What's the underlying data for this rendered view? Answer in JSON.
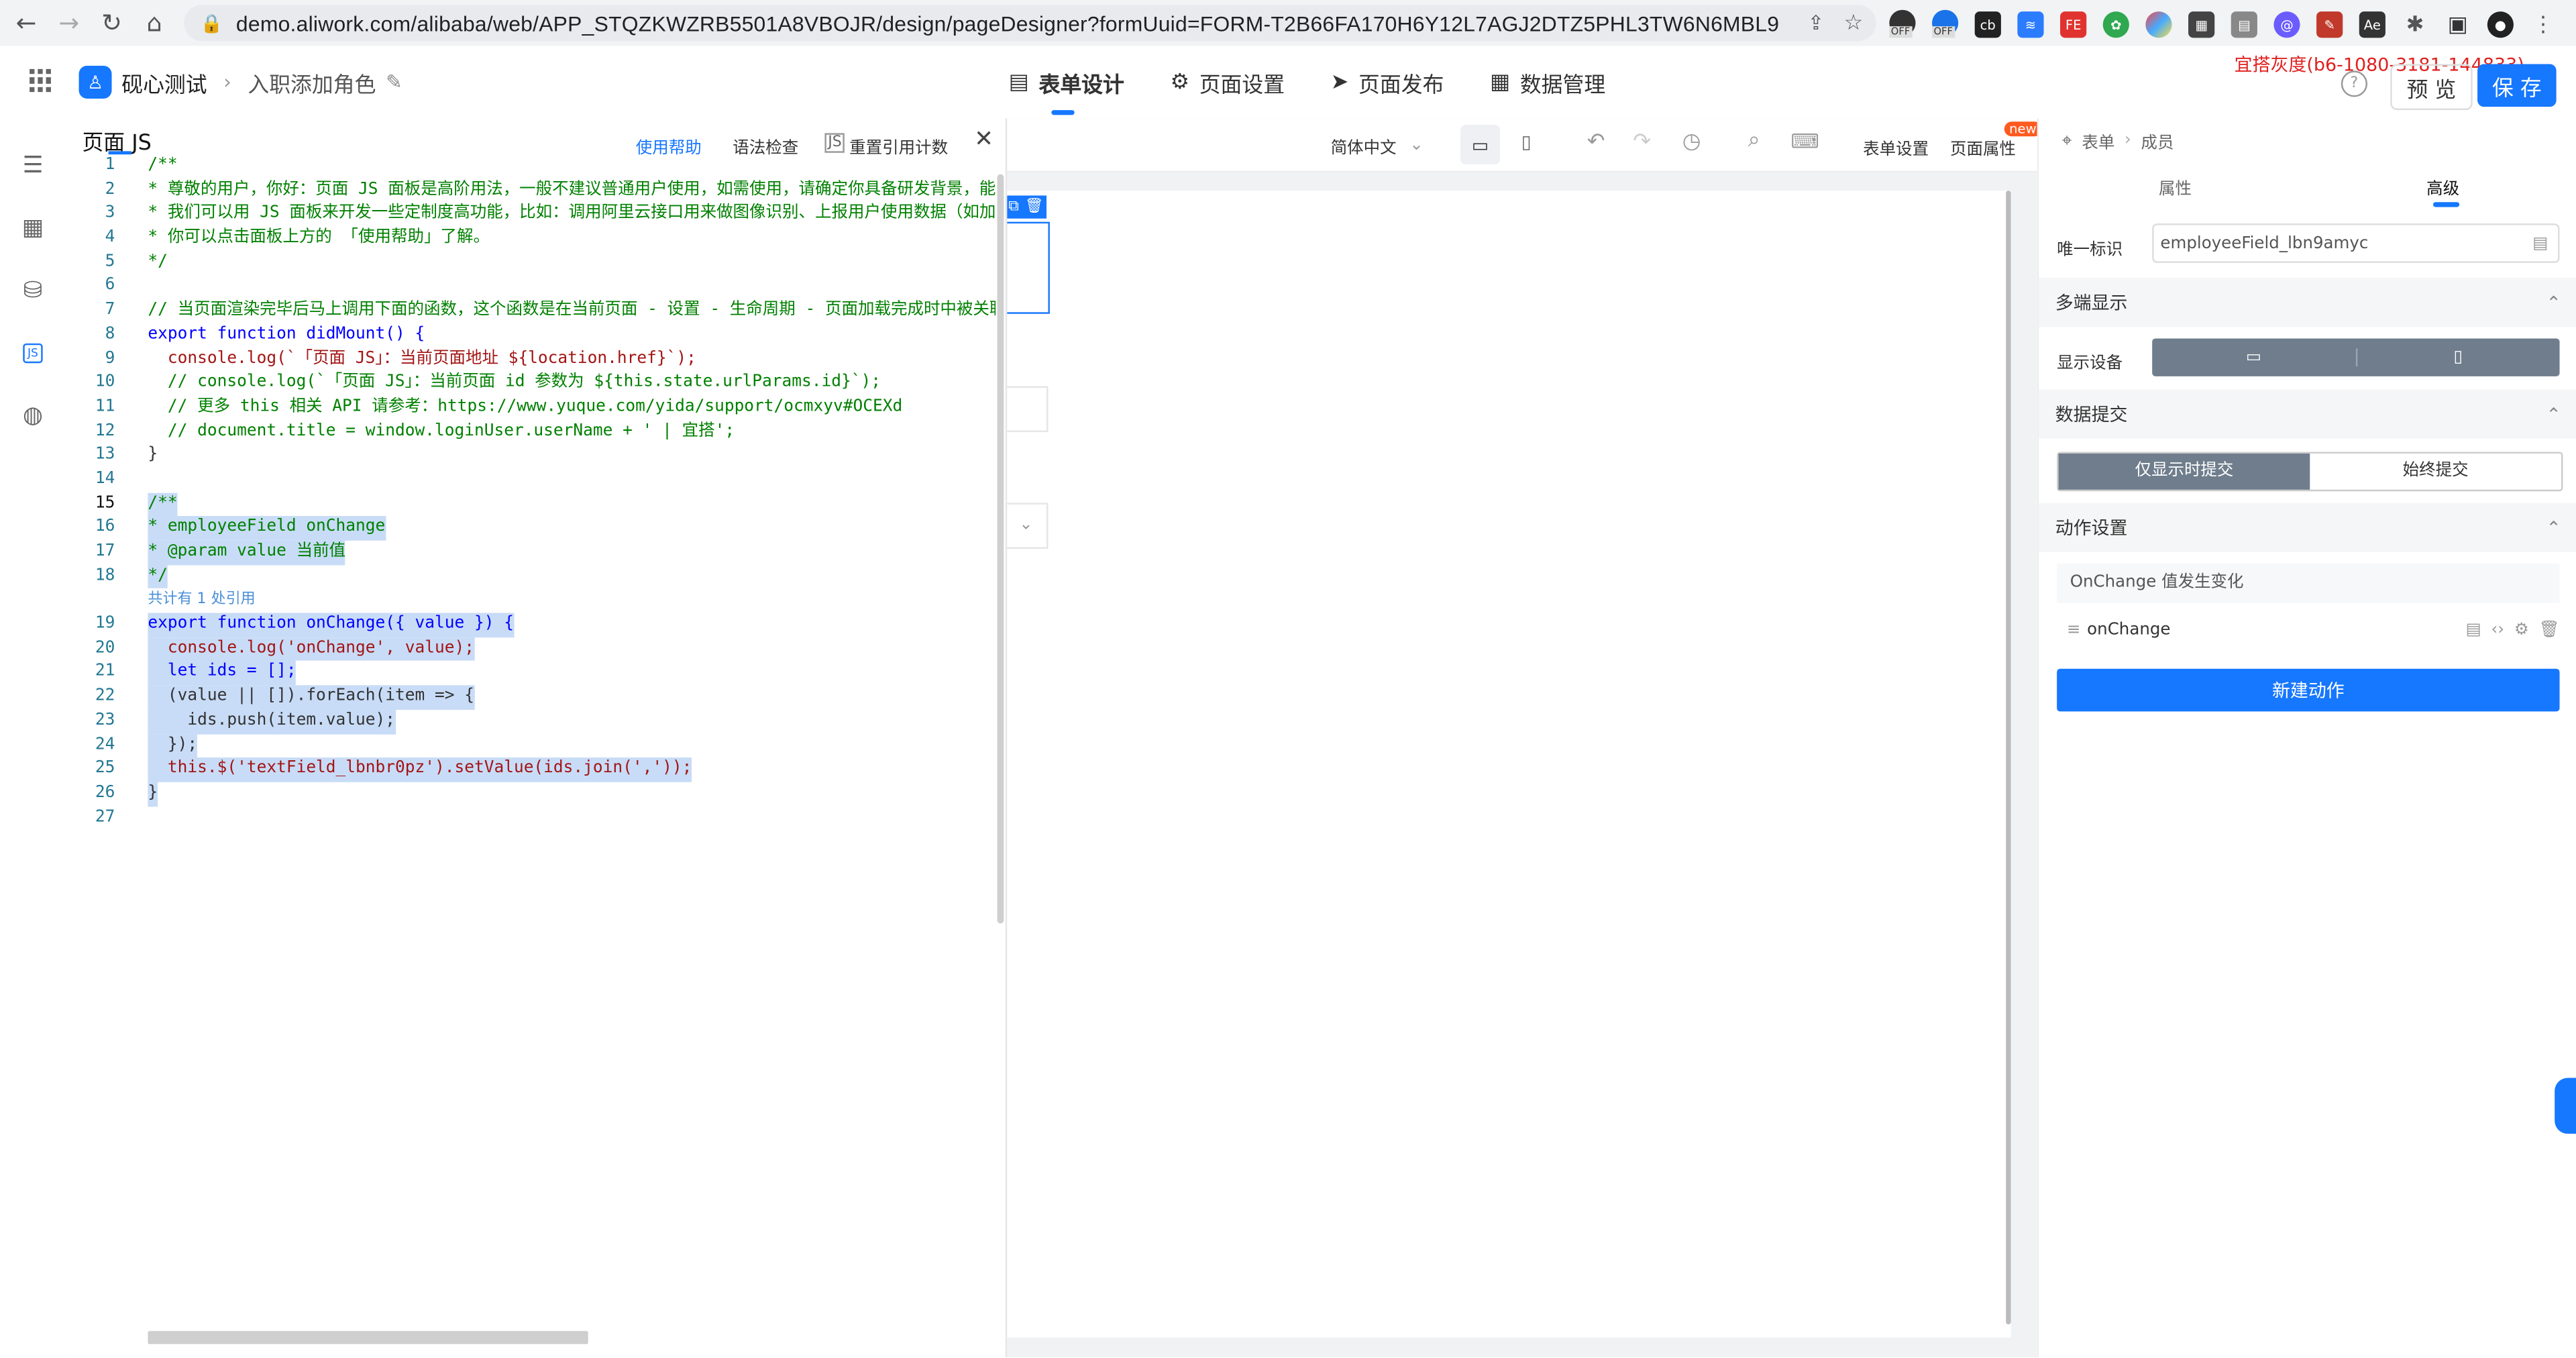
{
  "browser": {
    "url": "demo.aliwork.com/alibaba/web/APP_STQZKWZRB5501A8VBOJR/design/pageDesigner?formUuid=FORM-T2B66FA170H6Y12L7AGJ2DTZ5PHL3TW6N6MBL9",
    "ext_off_1": "OFF",
    "ext_off_2": "OFF"
  },
  "header": {
    "app_name": "砚心测试",
    "page_name": "入职添加角色",
    "tabs": [
      "表单设计",
      "页面设置",
      "页面发布",
      "数据管理"
    ],
    "env_label": "宜搭灰度(b6-1080-3181-144833)",
    "preview_label": "预 览",
    "save_label": "保 存"
  },
  "js_panel": {
    "title": "页面 JS",
    "help": "使用帮助",
    "syntax_check": "语法检查",
    "reset_ref": "重置引用计数",
    "ref_hint": "共计有 1 处引用",
    "lines": [
      {
        "n": "1",
        "t": "/**",
        "c": "com"
      },
      {
        "n": "2",
        "t": "* 尊敬的用户，你好：页面 JS 面板是高阶用法，一般不建议普通用户使用，如需使用，请确定你具备研发背景，能够自",
        "c": "com"
      },
      {
        "n": "3",
        "t": "* 我们可以用 JS 面板来开发一些定制度高功能，比如：调用阿里云接口用来做图像识别、上报用户使用数据（如加载完",
        "c": "com"
      },
      {
        "n": "4",
        "t": "* 你可以点击面板上方的 「使用帮助」了解。",
        "c": "com"
      },
      {
        "n": "5",
        "t": "*/",
        "c": "com"
      },
      {
        "n": "6",
        "t": "",
        "c": ""
      },
      {
        "n": "7",
        "t": "// 当页面渲染完毕后马上调用下面的函数，这个函数是在当前页面 - 设置 - 生命周期 - 页面加载完成时中被关联的。",
        "c": "com"
      },
      {
        "n": "8",
        "t": "export function didMount() {",
        "c": "kw"
      },
      {
        "n": "9",
        "t": "  console.log(`「页面 JS」：当前页面地址 ${location.href}`);",
        "c": "str"
      },
      {
        "n": "10",
        "t": "  // console.log(`「页面 JS」：当前页面 id 参数为 ${this.state.urlParams.id}`);",
        "c": "com"
      },
      {
        "n": "11",
        "t": "  // 更多 this 相关 API 请参考：https://www.yuque.com/yida/support/ocmxyv#OCEXd",
        "c": "com"
      },
      {
        "n": "12",
        "t": "  // document.title = window.loginUser.userName + ' | 宜搭';",
        "c": "com"
      },
      {
        "n": "13",
        "t": "}",
        "c": ""
      },
      {
        "n": "14",
        "t": "",
        "c": ""
      },
      {
        "n": "15",
        "t": "/**",
        "c": "com",
        "sel": true
      },
      {
        "n": "16",
        "t": "* employeeField onChange",
        "c": "com",
        "sel": true
      },
      {
        "n": "17",
        "t": "* @param value 当前值",
        "c": "com",
        "sel": true
      },
      {
        "n": "18",
        "t": "*/",
        "c": "com",
        "sel": true
      },
      {
        "n": "19",
        "t": "export function onChange({ value }) {",
        "c": "kw",
        "sel": true
      },
      {
        "n": "20",
        "t": "  console.log('onChange', value);",
        "c": "str",
        "sel": true
      },
      {
        "n": "21",
        "t": "  let ids = [];",
        "c": "kw",
        "sel": true
      },
      {
        "n": "22",
        "t": "  (value || []).forEach(item => {",
        "c": "",
        "sel": true
      },
      {
        "n": "23",
        "t": "    ids.push(item.value);",
        "c": "",
        "sel": true
      },
      {
        "n": "24",
        "t": "  });",
        "c": "",
        "sel": true
      },
      {
        "n": "25",
        "t": "  this.$('textField_lbnbr0pz').setValue(ids.join(','));",
        "c": "str",
        "sel": true
      },
      {
        "n": "26",
        "t": "}",
        "c": "",
        "sel": true
      },
      {
        "n": "27",
        "t": "",
        "c": ""
      }
    ]
  },
  "toolbar": {
    "lang": "简体中文",
    "form_settings": "表单设置",
    "page_props": "页面属性",
    "new_badge": "new"
  },
  "right_panel": {
    "breadcrumb_1": "表单",
    "breadcrumb_2": "成员",
    "tab_props": "属性",
    "tab_advanced": "高级",
    "unique_id_label": "唯一标识",
    "unique_id_value": "employeeField_lbn9amyc",
    "multi_display": "多端显示",
    "display_device": "显示设备",
    "data_submit": "数据提交",
    "submit_opt_1": "仅显示时提交",
    "submit_opt_2": "始终提交",
    "action_settings": "动作设置",
    "event_label": "OnChange 值发生变化",
    "handler_name": "onChange",
    "new_action": "新建动作"
  },
  "colors": {
    "primary": "#1677ff",
    "accent_red": "#e02020",
    "selection": "#c8dcf7"
  }
}
